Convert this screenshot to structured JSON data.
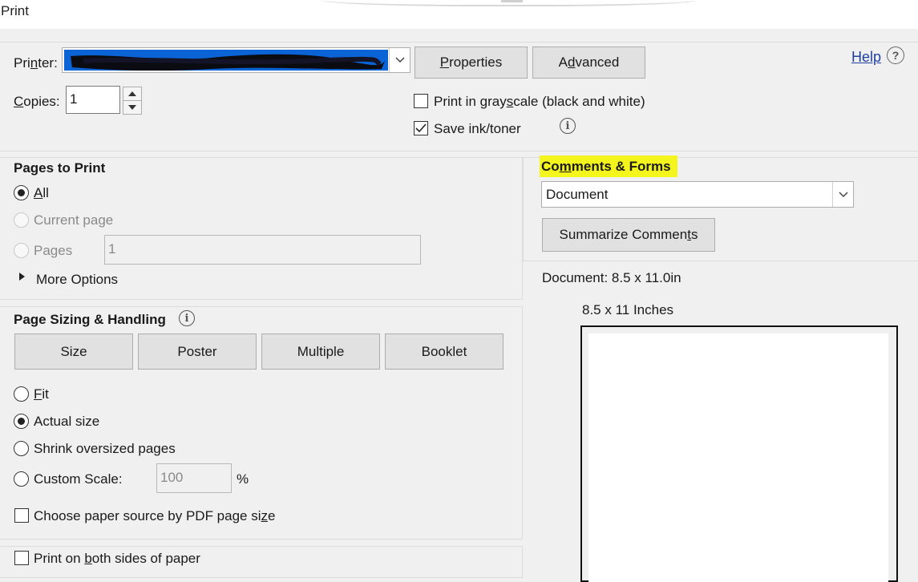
{
  "window": {
    "title": "Print"
  },
  "printer": {
    "label_pre": "Pri",
    "label_ul": "n",
    "label_post": "ter:",
    "properties_pre": "",
    "properties_ul": "P",
    "properties_post": "roperties",
    "advanced_pre": "A",
    "advanced_ul": "d",
    "advanced_post": "vanced",
    "help": "Help"
  },
  "copies": {
    "label_ul": "C",
    "label_post": "opies:",
    "value": "1"
  },
  "options": {
    "grayscale_pre": "Print in gray",
    "grayscale_ul": "s",
    "grayscale_post": "cale (black and white)",
    "grayscale_checked": false,
    "save_ink": "Save ink/toner",
    "save_ink_checked": true
  },
  "pages_to_print": {
    "title": "Pages to Print",
    "all_ul": "A",
    "all_post": "ll",
    "current_page": "Current page",
    "pages": "Pages",
    "pages_value": "1",
    "more_options": "More Options",
    "selected": "all"
  },
  "page_sizing": {
    "title": "Page Sizing & Handling",
    "tabs": [
      "Size",
      "Poster",
      "Multiple",
      "Booklet"
    ],
    "fit_ul": "F",
    "fit_post": "it",
    "actual_size": "Actual size",
    "shrink": "Shrink oversized pages",
    "custom_scale": "Custom Scale:",
    "scale_value": "100",
    "percent": "%",
    "paper_source_pre": "Choose paper source by PDF page si",
    "paper_source_ul": "z",
    "paper_source_post": "e",
    "selected": "actual_size"
  },
  "both_sides": {
    "pre": "Print on ",
    "ul": "b",
    "post": "oth sides of paper"
  },
  "comments_forms": {
    "title_pre": "Co",
    "title_ul": "m",
    "title_post": "ments & Forms",
    "value": "Document",
    "summarize_pre": "Summarize Commen",
    "summarize_ul": "t",
    "summarize_post": "s"
  },
  "preview": {
    "document_size": "Document: 8.5 x 11.0in",
    "paper_size": "8.5 x 11 Inches"
  },
  "colors": {
    "highlight": "#f5f51e",
    "link": "#1f3f9e"
  }
}
